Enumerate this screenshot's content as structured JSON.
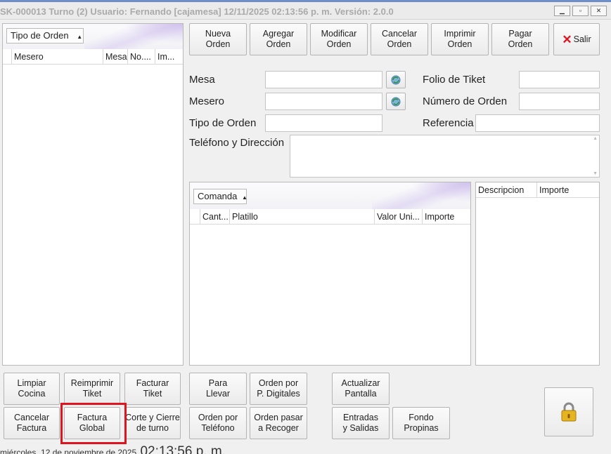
{
  "window": {
    "title": "SK-000013 Turno (2) Usuario: Fernando [cajamesa] 12/11/2025 02:13:56 p. m. Versión: 2.0.0",
    "controls": [
      "minimize",
      "maximize",
      "close"
    ]
  },
  "orders_panel": {
    "group_label": "Tipo de Orden",
    "columns": [
      "Mesero",
      "Mesa",
      "No....",
      "Im..."
    ],
    "rows": []
  },
  "toolbar": {
    "nueva_orden": "Nueva\nOrden",
    "agregar_orden": "Agregar\nOrden",
    "modificar_orden": "Modificar\nOrden",
    "cancelar_orden": "Cancelar\nOrden",
    "imprimir_orden": "Imprimir\nOrden",
    "pagar_orden": "Pagar\nOrden",
    "salir": "Salir"
  },
  "form": {
    "mesa_label": "Mesa",
    "mesa_value": "",
    "mesero_label": "Mesero",
    "mesero_value": "",
    "tipo_label": "Tipo de Orden",
    "tipo_value": "",
    "telefono_label": "Teléfono y Dirección",
    "telefono_value": "",
    "folio_label": "Folio de Tiket",
    "folio_value": "",
    "numero_label": "Número de Orden",
    "numero_value": "",
    "referencia_label": "Referencia",
    "referencia_value": ""
  },
  "comanda": {
    "group_label": "Comanda",
    "columns": [
      "Cant...",
      "Platillo",
      "Valor Uni...",
      "Importe"
    ],
    "rows": []
  },
  "summary": {
    "columns": [
      "Descripcion",
      "Importe"
    ],
    "rows": []
  },
  "bottom_buttons": {
    "limpiar_cocina": "Limpiar\nCocina",
    "reimprimir_tiket": "Reimprimir\nTiket",
    "facturar_tiket": "Facturar\nTiket",
    "cancelar_factura": "Cancelar\nFactura",
    "factura_global": "Factura\nGlobal",
    "corte_cierre": "Corte y Cierre\nde turno",
    "para_llevar": "Para\nLlevar",
    "orden_digitales": "Orden por\nP. Digitales",
    "orden_telefono": "Orden por\nTeléfono",
    "orden_recoger": "Orden pasar\na Recoger",
    "actualizar_pantalla": "Actualizar\nPantalla",
    "entradas_salidas": "Entradas\ny Salidas",
    "fondo_propinas": "Fondo\nPropinas"
  },
  "status": {
    "date": "miércoles, 12 de noviembre de 2025",
    "time": "02:13:56 p. m."
  },
  "colors": {
    "highlight": "#e0141e",
    "salir_icon": "#e0141e",
    "window_accent": "#6e8fc9"
  }
}
